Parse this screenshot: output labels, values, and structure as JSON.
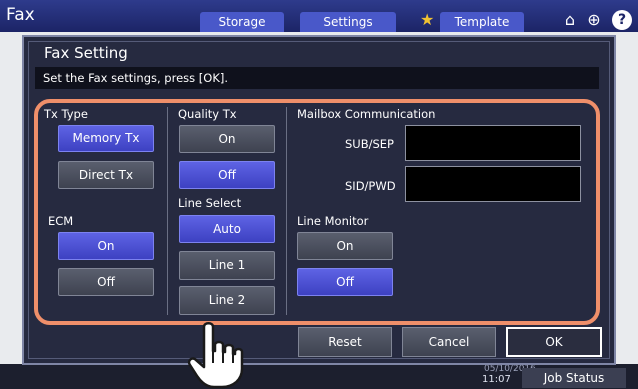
{
  "background": {
    "app_title": "Fax",
    "tabs": [
      "Storage",
      "Settings",
      "Template"
    ],
    "date": "05/10/2016",
    "time": "11:07",
    "job_status_label": "Job Status",
    "help_label": "?"
  },
  "dialog": {
    "title": "Fax Setting",
    "instruction": "Set the Fax settings, press [OK]."
  },
  "tx_type": {
    "label": "Tx Type",
    "memory_tx": "Memory Tx",
    "direct_tx": "Direct Tx",
    "selected": "Memory Tx"
  },
  "ecm": {
    "label": "ECM",
    "on": "On",
    "off": "Off",
    "selected": "On"
  },
  "quality_tx": {
    "label": "Quality Tx",
    "on": "On",
    "off": "Off",
    "selected": "Off"
  },
  "line_select": {
    "label": "Line Select",
    "auto": "Auto",
    "line1": "Line 1",
    "line2": "Line 2",
    "selected": "Auto"
  },
  "mailbox": {
    "label": "Mailbox Communication",
    "sub_sep_label": "SUB/SEP",
    "sub_sep_value": "",
    "sid_pwd_label": "SID/PWD",
    "sid_pwd_value": ""
  },
  "line_monitor": {
    "label": "Line Monitor",
    "on": "On",
    "off": "Off",
    "selected": "Off"
  },
  "actions": {
    "reset": "Reset",
    "cancel": "Cancel",
    "ok": "OK"
  },
  "colors": {
    "selected_button": "#4b50d6",
    "highlight_outline": "#ef8f6a",
    "dialog_background": "#262a40",
    "header_background": "#1c2466"
  }
}
